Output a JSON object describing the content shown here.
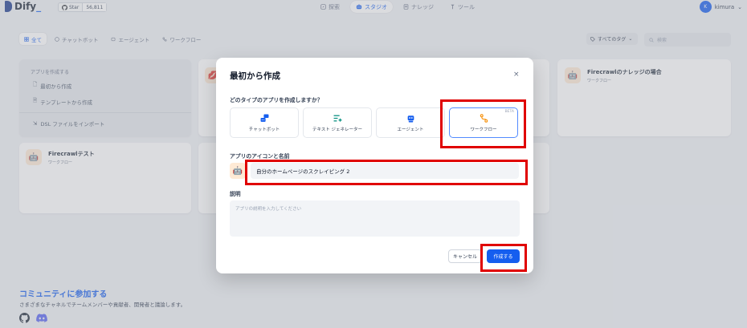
{
  "header": {
    "logo_text": "Dify",
    "github": {
      "star_label": "Star",
      "star_count": "56,811"
    },
    "nav": [
      {
        "label": "探索",
        "icon": "compass-icon"
      },
      {
        "label": "スタジオ",
        "icon": "robot-icon"
      },
      {
        "label": "ナレッジ",
        "icon": "book-icon"
      },
      {
        "label": "ツール",
        "icon": "wrench-icon"
      }
    ],
    "user": {
      "initial": "K",
      "name": "kimura"
    }
  },
  "filters": {
    "chips": [
      "全て",
      "チャットボット",
      "エージェント",
      "ワークフロー"
    ],
    "tag_select": "すべてのタグ",
    "search_placeholder": "検索"
  },
  "create_card": {
    "heading": "アプリを作成する",
    "options": [
      "最初から作成",
      "テンプレートから作成"
    ],
    "import": "DSL ファイルをインポート"
  },
  "apps": [
    {
      "title": "Firecrawlのナレッジの場合",
      "type": "ワークフロー"
    },
    {
      "title": "Firecrawlテスト",
      "type": "ワークフロー"
    }
  ],
  "community": {
    "title": "コミュニティに参加する",
    "desc": "さまざまなチャネルでチームメンバーや貢献者、開発者と議論します。"
  },
  "modal": {
    "title": "最初から作成",
    "close": "×",
    "question": "どのタイプのアプリを作成しますか？",
    "types": [
      {
        "label": "チャットボット",
        "icon": "chatbot-icon",
        "color": "#155eef"
      },
      {
        "label": "テキスト ジェネレーター",
        "icon": "text-generator-icon",
        "color": "#0e9384"
      },
      {
        "label": "エージェント",
        "icon": "agent-icon",
        "color": "#155eef"
      },
      {
        "label": "ワークフロー",
        "icon": "workflow-icon",
        "color": "#f79009",
        "badge": "BETA"
      }
    ],
    "name_label": "アプリのアイコンと名前",
    "name_value": "自分のホームページのスクレイピング 2",
    "desc_label": "説明",
    "desc_placeholder": "アプリの説明を入力してください",
    "cancel": "キャンセル",
    "create": "作成する"
  },
  "colors": {
    "accent": "#155eef",
    "highlight": "#e00000"
  }
}
